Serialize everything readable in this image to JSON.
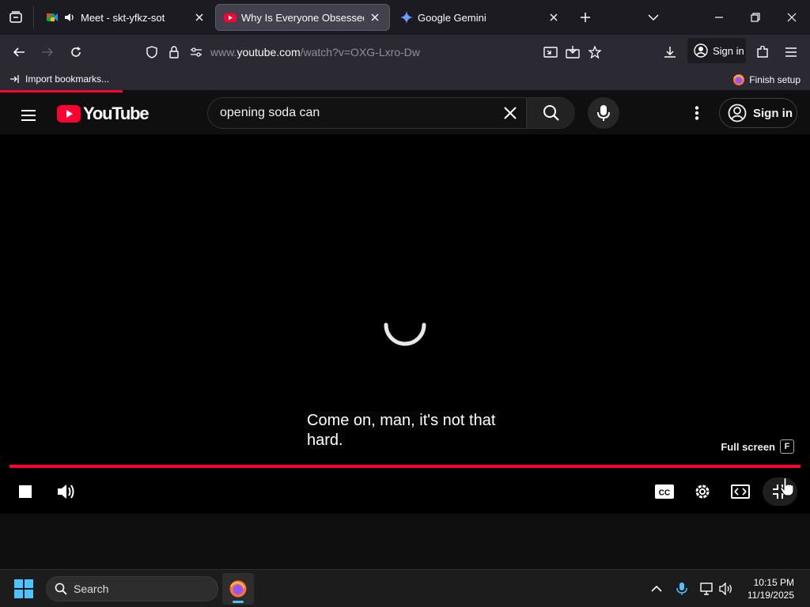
{
  "browser": {
    "tabs": [
      {
        "title": "Meet - skt-yfkz-sot",
        "active": false,
        "playing_audio": true
      },
      {
        "title": "Why Is Everyone Obsessed With",
        "active": true
      },
      {
        "title": "Google Gemini",
        "active": false
      }
    ],
    "url": {
      "prefix": "www.",
      "domain": "youtube.com",
      "path": "/watch?v=OXG-Lxro-Dw"
    },
    "sign_in_label": "Sign in",
    "bookmarks": {
      "import_label": "Import bookmarks...",
      "finish_label": "Finish setup"
    }
  },
  "youtube": {
    "logo_text": "YouTube",
    "search": {
      "value": "opening soda can",
      "placeholder": "Search"
    },
    "sign_in_label": "Sign in",
    "brand_color": "#ff0033"
  },
  "player": {
    "caption_line1": "Come on, man, it's not that",
    "caption_line2": "hard.",
    "fullscreen_tip": "Full screen",
    "fullscreen_key": "F",
    "progress_fraction": 1.0,
    "state": "loading"
  },
  "taskbar": {
    "search_label": "Search",
    "time": "10:15 PM",
    "date": "11/19/2025"
  }
}
